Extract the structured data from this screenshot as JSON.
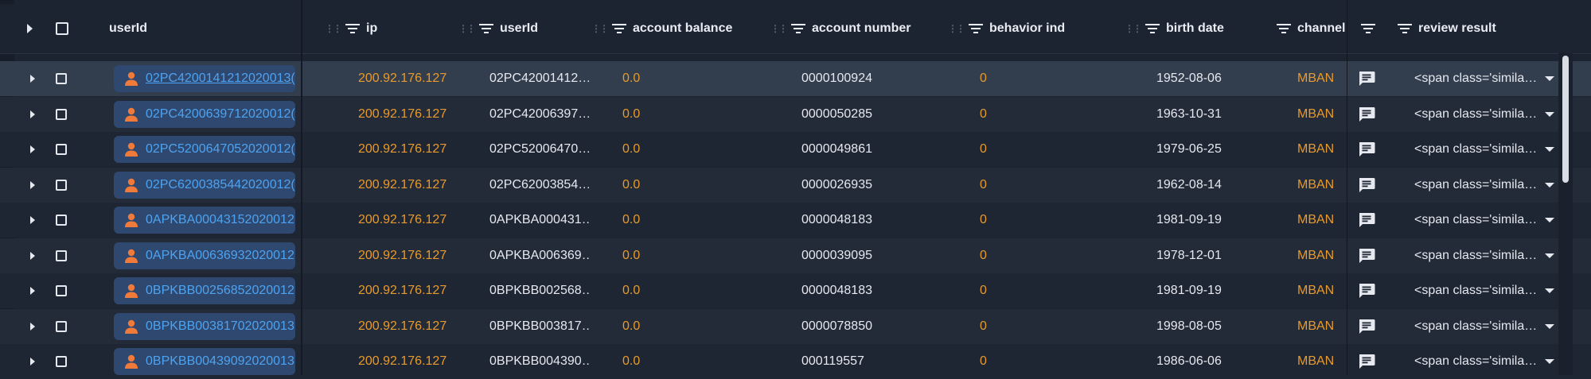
{
  "columns": {
    "pinned_userid": "userId",
    "ip": "ip",
    "userid": "userId",
    "account_balance": "account balance",
    "account_number": "account number",
    "behavior_ind": "behavior ind",
    "birth_date": "birth date",
    "channel": "channel",
    "review_result": "review result"
  },
  "icons": {
    "expand": "caret-right-icon",
    "checkbox": "checkbox-icon",
    "filter": "filter-icon",
    "drag": "drag-handle-icon",
    "user": "person-icon",
    "comment": "comment-icon",
    "dropdown": "chevron-down-icon"
  },
  "colors": {
    "accent_orange": "#e89b2c",
    "link_blue": "#4ea3f0",
    "chip_bg": "#2e4870",
    "person_icon": "#f07a3a"
  },
  "rows": [
    {
      "pinned_userid": "02PC4200141212020013(",
      "ip": "200.92.176.127",
      "userid": "02PC42001412…",
      "balance": "0.0",
      "account_number": "0000100924",
      "behavior": "0",
      "birth_date": "1952-08-06",
      "channel": "MBAN",
      "review": "<span class='simila…"
    },
    {
      "pinned_userid": "02PC4200639712020012(",
      "ip": "200.92.176.127",
      "userid": "02PC42006397…",
      "balance": "0.0",
      "account_number": "0000050285",
      "behavior": "0",
      "birth_date": "1963-10-31",
      "channel": "MBAN",
      "review": "<span class='simila…"
    },
    {
      "pinned_userid": "02PC5200647052020012(",
      "ip": "200.92.176.127",
      "userid": "02PC52006470…",
      "balance": "0.0",
      "account_number": "0000049861",
      "behavior": "0",
      "birth_date": "1979-06-25",
      "channel": "MBAN",
      "review": "<span class='simila…"
    },
    {
      "pinned_userid": "02PC6200385442020012(",
      "ip": "200.92.176.127",
      "userid": "02PC62003854…",
      "balance": "0.0",
      "account_number": "0000026935",
      "behavior": "0",
      "birth_date": "1962-08-14",
      "channel": "MBAN",
      "review": "<span class='simila…"
    },
    {
      "pinned_userid": "0APKBA00043152020012",
      "ip": "200.92.176.127",
      "userid": "0APKBA000431…",
      "balance": "0.0",
      "account_number": "0000048183",
      "behavior": "0",
      "birth_date": "1981-09-19",
      "channel": "MBAN",
      "review": "<span class='simila…"
    },
    {
      "pinned_userid": "0APKBA00636932020012",
      "ip": "200.92.176.127",
      "userid": "0APKBA006369…",
      "balance": "0.0",
      "account_number": "0000039095",
      "behavior": "0",
      "birth_date": "1978-12-01",
      "channel": "MBAN",
      "review": "<span class='simila…"
    },
    {
      "pinned_userid": "0BPKBB00256852020012",
      "ip": "200.92.176.127",
      "userid": "0BPKBB002568…",
      "balance": "0.0",
      "account_number": "0000048183",
      "behavior": "0",
      "birth_date": "1981-09-19",
      "channel": "MBAN",
      "review": "<span class='simila…"
    },
    {
      "pinned_userid": "0BPKBB00381702020013",
      "ip": "200.92.176.127",
      "userid": "0BPKBB003817…",
      "balance": "0.0",
      "account_number": "0000078850",
      "behavior": "0",
      "birth_date": "1998-08-05",
      "channel": "MBAN",
      "review": "<span class='simila…"
    },
    {
      "pinned_userid": "0BPKBB00439092020013",
      "ip": "200.92.176.127",
      "userid": "0BPKBB004390…",
      "balance": "0.0",
      "account_number": "000119557",
      "behavior": "0",
      "birth_date": "1986-06-06",
      "channel": "MBAN",
      "review": "<span class='simila…"
    }
  ]
}
